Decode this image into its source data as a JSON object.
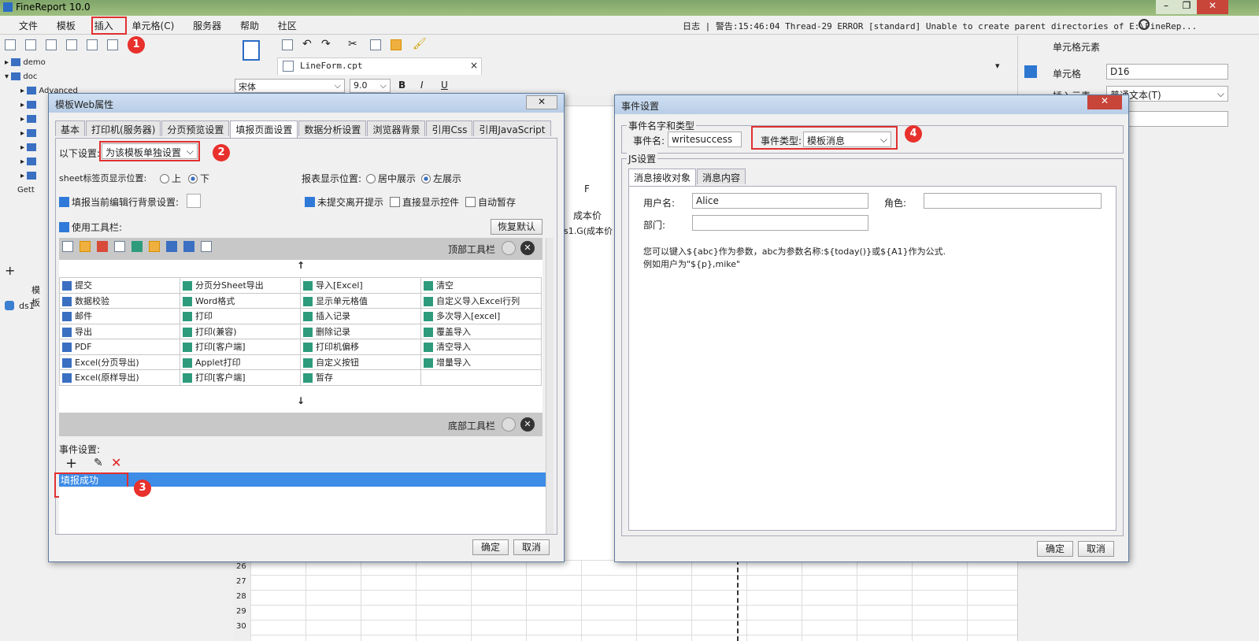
{
  "app": {
    "title": "FineReport 10.0"
  },
  "menu": {
    "items": [
      "文件",
      "模板",
      "插入",
      "单元格(C)",
      "服务器",
      "帮助",
      "社区"
    ]
  },
  "log": {
    "text": "日志 | 警告:15:46:04 Thread-29 ERROR [standard] Unable to create parent directories of E:\\FineRep..."
  },
  "file_tab": {
    "name": "LineForm.cpt"
  },
  "font": {
    "name": "宋体",
    "size": "9.0"
  },
  "tree": {
    "items": [
      "demo",
      "doc",
      "Advanced",
      "Gett"
    ],
    "bottom": [
      "模板",
      "ds1"
    ]
  },
  "right_panel": {
    "title": "单元格元素",
    "cell_label": "单元格",
    "cell_value": "D16",
    "insert_label": "插入元素",
    "insert_value": "普通文本(T)"
  },
  "sheet": {
    "col_F": "F",
    "cost_header": "成本价",
    "cost_formula": "s1.G(成本价",
    "rows": [
      "26",
      "27",
      "28",
      "29",
      "30"
    ]
  },
  "web_dialog": {
    "title": "模板Web属性",
    "tabs": [
      "基本",
      "打印机(服务器)",
      "分页预览设置",
      "填报页面设置",
      "数据分析设置",
      "浏览器背景",
      "引用Css",
      "引用JavaScript"
    ],
    "setting_label": "以下设置:",
    "setting_value": "为该模板单独设置",
    "sheet_pos_label": "sheet标签页显示位置:",
    "pos_up": "上",
    "pos_down": "下",
    "report_pos_label": "报表显示位置:",
    "center": "居中展示",
    "left": "左展示",
    "bg_label": "填报当前编辑行背景设置:",
    "unsubmit": "未提交离开提示",
    "direct": "直接显示控件",
    "autosave": "自动暂存",
    "use_toolbar": "使用工具栏:",
    "restore": "恢复默认",
    "top_toolbar": "顶部工具栏",
    "bottom_toolbar": "底部工具栏",
    "arrow_up": "↑",
    "arrow_down": "↓",
    "buttons": [
      [
        "提交",
        "分页分Sheet导出",
        "导入[Excel]",
        "清空"
      ],
      [
        "数据校验",
        "Word格式",
        "显示单元格值",
        "自定义导入Excel行列"
      ],
      [
        "邮件",
        "打印",
        "插入记录",
        "多次导入[excel]"
      ],
      [
        "导出",
        "打印(兼容)",
        "删除记录",
        "覆盖导入"
      ],
      [
        "PDF",
        "打印[客户端]",
        "打印机偏移",
        "清空导入"
      ],
      [
        "Excel(分页导出)",
        "Applet打印",
        "自定义按钮",
        "增量导入"
      ],
      [
        "Excel(原样导出)",
        "打印[客户端]",
        "暂存",
        ""
      ]
    ],
    "event_label": "事件设置:",
    "event_item": "填报成功",
    "ok": "确定",
    "cancel": "取消"
  },
  "event_dialog": {
    "title": "事件设置",
    "group1": "事件名字和类型",
    "name_label": "事件名:",
    "name_value": "writesuccess",
    "type_label": "事件类型:",
    "type_value": "模板消息",
    "group2": "JS设置",
    "tab1": "消息接收对象",
    "tab2": "消息内容",
    "user_label": "用户名:",
    "user_value": "Alice",
    "role_label": "角色:",
    "dept_label": "部门:",
    "hint1": "您可以键入${abc}作为参数，abc为参数名称:${today()}或${A1}作为公式.",
    "hint2": "例如用户为\"${p},mike\"",
    "ok": "确定",
    "cancel": "取消"
  },
  "badges": [
    "1",
    "2",
    "3",
    "4"
  ]
}
